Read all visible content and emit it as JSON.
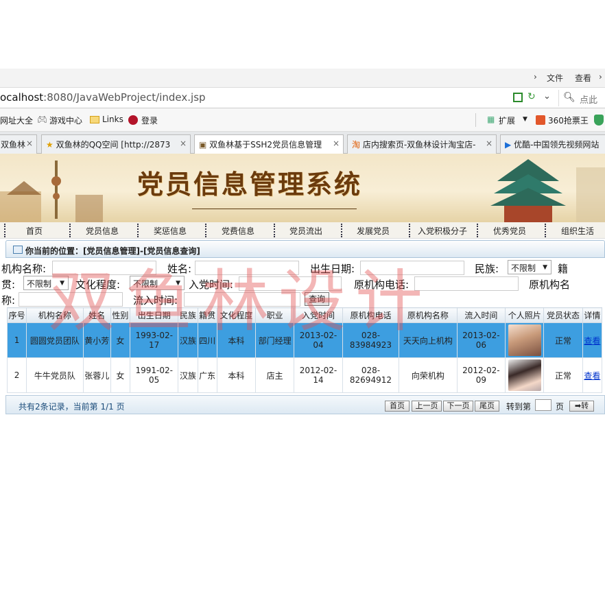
{
  "browser": {
    "menu": {
      "file": "文件",
      "view": "查看"
    },
    "url_host": "ocalhost",
    "url_rest": ":8080/JavaWebProject/index.jsp",
    "search_placeholder": "点此搜",
    "bookmarks": [
      "网址大全",
      "游戏中心",
      "Links",
      "登录"
    ],
    "extensions_label": "扩展",
    "ticket_label": "360抢票王",
    "tabs": [
      {
        "label": "双鱼林"
      },
      {
        "label": "双鱼林的QQ空间 [http://2873"
      },
      {
        "label": "双鱼林基于SSH2党员信息管理"
      },
      {
        "label": "店内搜索页-双鱼林设计淘宝店-"
      },
      {
        "label": "优酷-中国领先视频网站"
      }
    ]
  },
  "banner": {
    "title": "党员信息管理系统"
  },
  "nav": [
    "首页",
    "党员信息",
    "奖惩信息",
    "党费信息",
    "党员流出",
    "发展党员",
    "入党积极分子",
    "优秀党员",
    "组织生活"
  ],
  "breadcrumb": "你当前的位置：[党员信息管理]-[党员信息查询]",
  "form": {
    "org_name": "机构名称:",
    "name": "姓名:",
    "birth": "出生日期:",
    "ethnic": "民族:",
    "ethnic_value": "不限制",
    "native_1": "籍",
    "native_2": "贯:",
    "native_value": "不限制",
    "education": "文化程度:",
    "education_value": "不限制",
    "join_time": "入党时间:",
    "orig_phone": "原机构电话:",
    "orig_org_1": "原机构名",
    "orig_org_2": "称:",
    "inflow_time": "流入时间:",
    "search_btn": "查询"
  },
  "table": {
    "headers": [
      "序号",
      "机构名称",
      "姓名",
      "性别",
      "出生日期",
      "民族",
      "籍贯",
      "文化程度",
      "职业",
      "入党时间",
      "原机构电话",
      "原机构名称",
      "流入时间",
      "个人照片",
      "党员状态",
      "详情"
    ],
    "rows": [
      [
        "1",
        "圆圆党员团队",
        "黄小芳",
        "女",
        "1993-02-17",
        "汉族",
        "四川",
        "本科",
        "部门经理",
        "2013-02-04",
        "028-83984923",
        "天天向上机构",
        "2013-02-06",
        "",
        "正常",
        "查看"
      ],
      [
        "2",
        "牛牛党员队",
        "张蓉儿",
        "女",
        "1991-02-05",
        "汉族",
        "广东",
        "本科",
        "店主",
        "2012-02-14",
        "028-82694912",
        "向荣机构",
        "2012-02-09",
        "",
        "正常",
        "查看"
      ]
    ]
  },
  "pager": {
    "info": "共有2条记录，当前第 1/1 页",
    "first": "首页",
    "prev": "上一页",
    "next": "下一页",
    "last": "尾页",
    "goto": "转到第",
    "page_unit": "页",
    "go": "➡转"
  },
  "watermark": "双鱼林设计"
}
